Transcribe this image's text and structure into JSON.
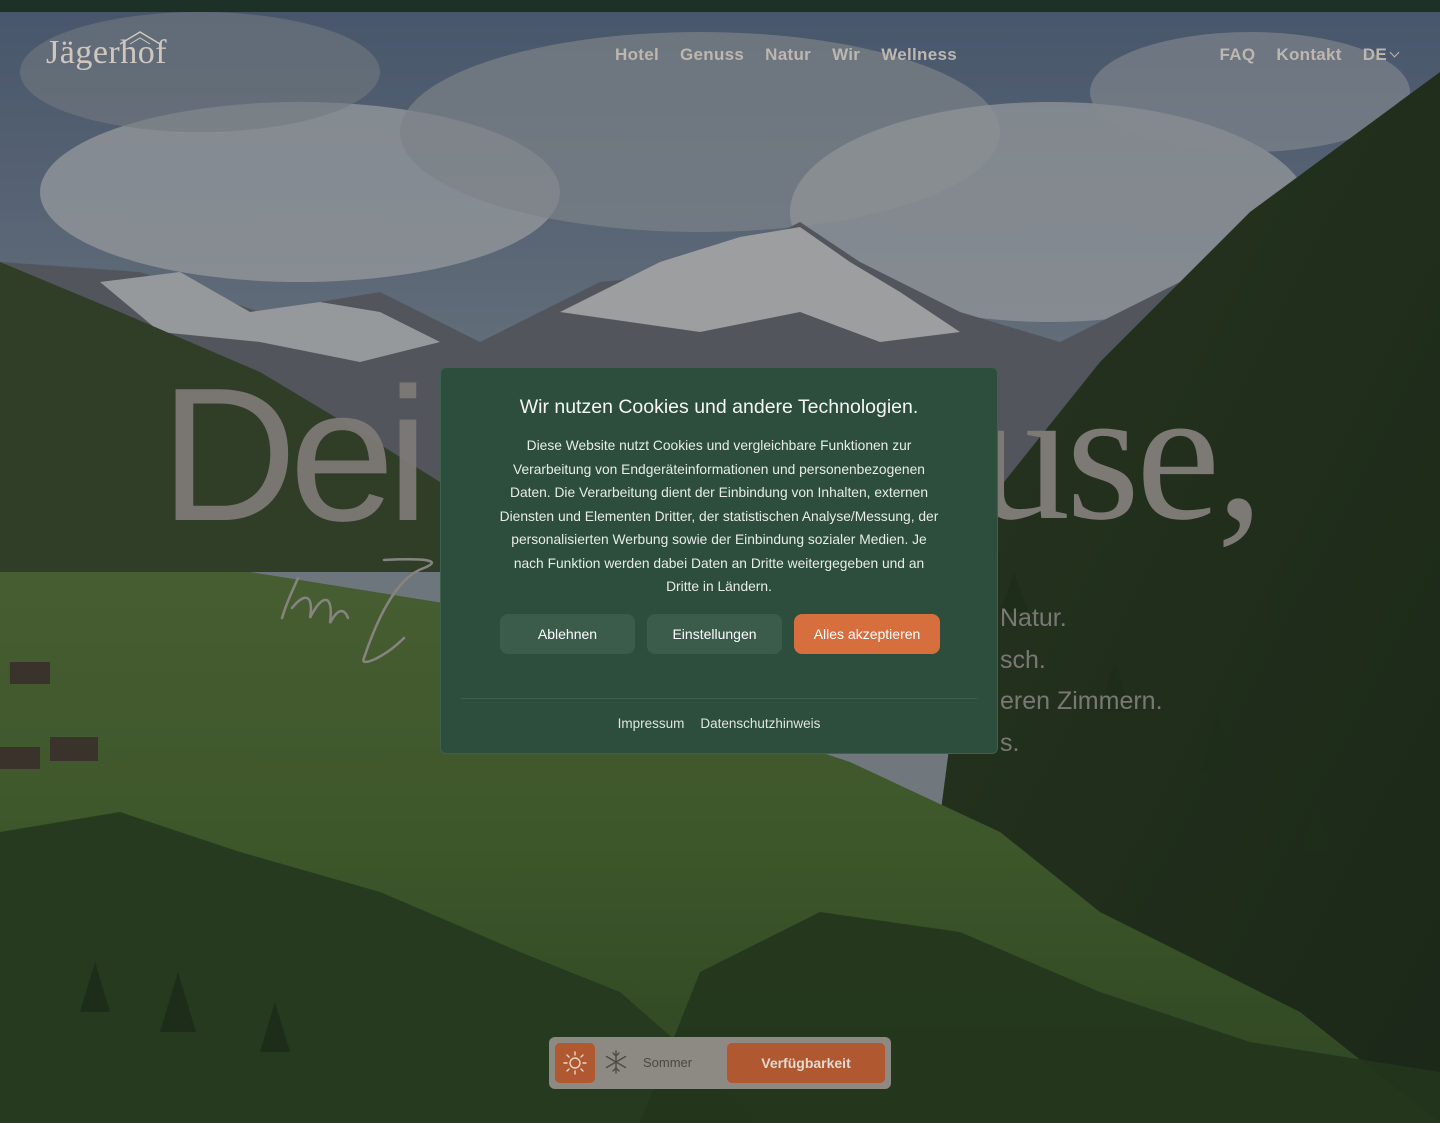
{
  "nav": {
    "logo_text": "Jägerhof",
    "items": [
      {
        "label": "Hotel"
      },
      {
        "label": "Genuss"
      },
      {
        "label": "Natur"
      },
      {
        "label": "Wir"
      },
      {
        "label": "Wellness"
      }
    ],
    "right_items": [
      {
        "label": "FAQ"
      },
      {
        "label": "Kontakt"
      }
    ],
    "language": "DE"
  },
  "hero": {
    "headline_left": "Dei",
    "headline_right": "use,",
    "subtext_lines": [
      "Natur.",
      "sch.",
      "eren Zimmern.",
      "s."
    ]
  },
  "cookie_dialog": {
    "title": "Wir nutzen Cookies und andere Technologien.",
    "body": "Diese Website nutzt Cookies und vergleichbare Funktionen zur Verarbeitung von Endgeräteinformationen und personenbezogenen Daten. Die Verarbeitung dient der Einbindung von Inhalten, externen Diensten und Elementen Dritter, der statistischen Analyse/Messung, der personalisierten Werbung sowie der Einbindung sozialer Medien. Je nach Funktion werden dabei Daten an Dritte weitergegeben und an Dritte in Ländern.",
    "buttons": {
      "decline": "Ablehnen",
      "settings": "Einstellungen",
      "accept": "Alles akzeptieren"
    },
    "links": {
      "imprint": "Impressum",
      "privacy": "Datenschutzhinweis"
    }
  },
  "booking_bar": {
    "season_label": "Sommer",
    "summer_icon": "sun-icon",
    "winter_icon": "snowflake-icon",
    "availability_label": "Verfügbarkeit"
  },
  "colors": {
    "dialog_bg": "#2d4d3d",
    "accent": "#d66f3d",
    "topbar": "#1d3127"
  }
}
